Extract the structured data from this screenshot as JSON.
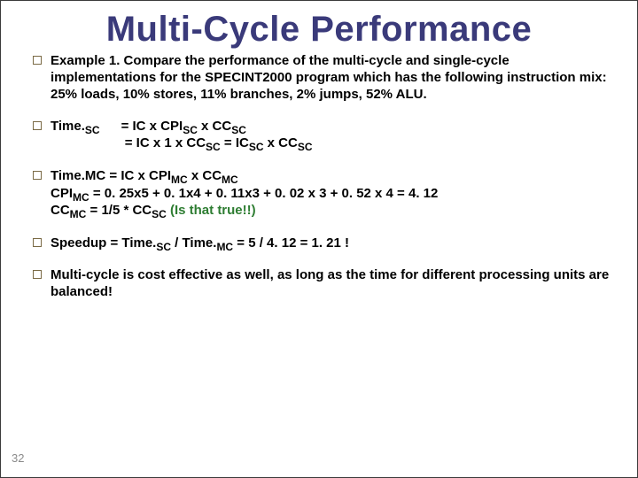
{
  "slide": {
    "title": "Multi-Cycle Performance",
    "page_number": "32",
    "bullets": {
      "b1": "Example 1. Compare the performance of the multi-cycle and single-cycle implementations for the SPECINT2000 program which has the following instruction mix: 25% loads, 10% stores, 11% branches, 2% jumps, 52% ALU.",
      "b2": {
        "label_pre": "Time.",
        "label_sub": "SC",
        "line1_a": "=  IC x CPI",
        "line1_b": "SC",
        "line1_c": " x CC",
        "line1_d": "SC",
        "line2_a": "=  IC x 1 x CC",
        "line2_b": "SC",
        "line2_c": " = IC",
        "line2_d": "SC",
        "line2_e": " x CC",
        "line2_f": "SC"
      },
      "b3": {
        "line1_a": "Time.MC   =  IC x CPI",
        "line1_b": "MC",
        "line1_c": " x CC",
        "line1_d": "MC",
        "line2_a": "CPI",
        "line2_b": "MC",
        "line2_c": "   =  0. 25x5 + 0. 1x4 + 0. 11x3 + 0. 02 x 3 + 0. 52 x 4 = 4. 12",
        "line3_a": "CC",
        "line3_b": "MC",
        "line3_c": "    =  1/5 * CC",
        "line3_d": "SC",
        "line3_e": "    (Is that true!!)"
      },
      "b4": {
        "a": "Speedup = Time.",
        "b": "SC",
        "c": "  / Time.",
        "d": "MC",
        "e": " = 5 / 4. 12 = 1. 21 !"
      },
      "b5": "Multi-cycle is cost effective as well, as long as the time for different processing units are balanced!"
    }
  }
}
